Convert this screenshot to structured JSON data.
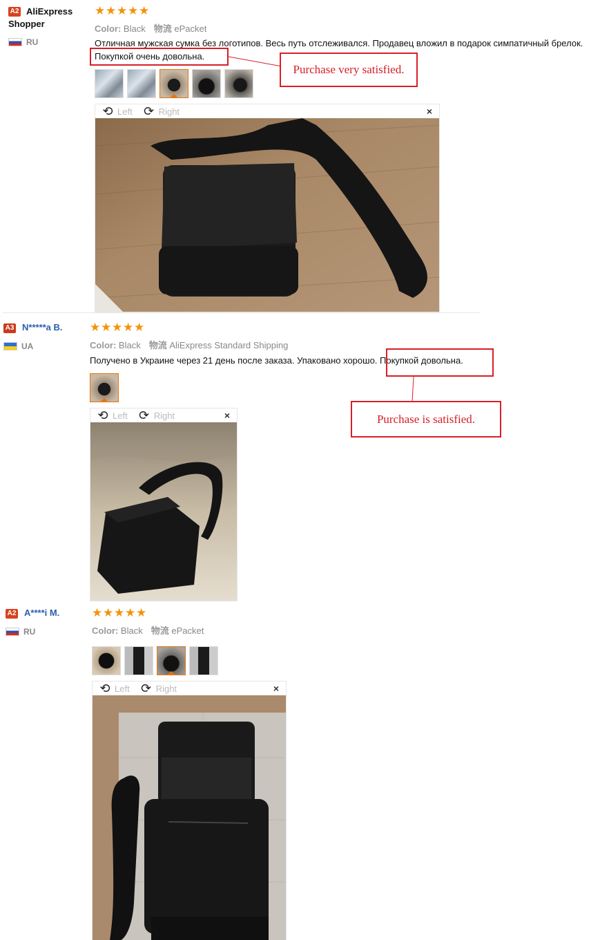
{
  "reviews": [
    {
      "badge": "A2",
      "user_name_line1": "AliExpress",
      "user_name_line2": "Shopper",
      "country": "RU",
      "color_label": "Color:",
      "color_value": "Black",
      "shipping_label": "物流",
      "shipping_value": "ePacket",
      "text": "Отличная мужская сумка без логотипов. Весь путь отслеживался. Продавец вложил в подарок симпатичный брелок.",
      "text2": "Покупкой очень довольна.",
      "annotation": "Purchase very satisfied.",
      "viewer": {
        "left": "Left",
        "right": "Right",
        "close": "×"
      }
    },
    {
      "badge": "A3",
      "user_name": "N*****a B.",
      "country": "UA",
      "color_label": "Color:",
      "color_value": "Black",
      "shipping_label": "物流",
      "shipping_value": "AliExpress Standard Shipping",
      "text": "Получено в Украине через 21 день после заказа. Упаковано хорошо. Покупкой довольна.",
      "annotation": "Purchase is satisfied.",
      "viewer": {
        "left": "Left",
        "right": "Right",
        "close": "×"
      }
    },
    {
      "badge": "A2",
      "user_name": "A****i M.",
      "country": "RU",
      "color_label": "Color:",
      "color_value": "Black",
      "shipping_label": "物流",
      "shipping_value": "ePacket",
      "viewer": {
        "left": "Left",
        "right": "Right",
        "close": "×"
      }
    }
  ],
  "rating_stars": "★★★★★",
  "colors": {
    "star": "#f3930a",
    "badge_a2": "#d8421f",
    "badge_a3": "#c93a1c",
    "annotation": "#d61f26",
    "user_link": "#2a5db0"
  }
}
